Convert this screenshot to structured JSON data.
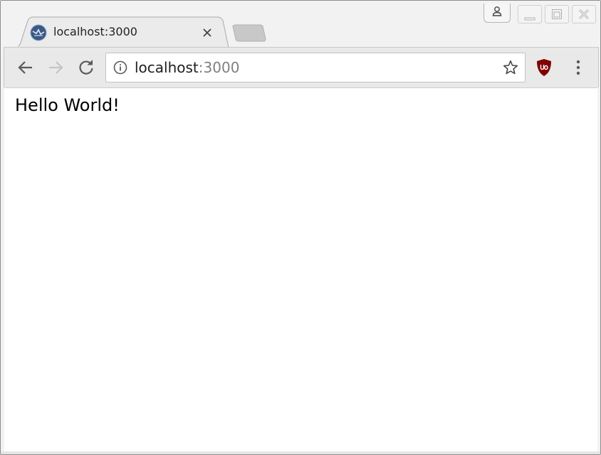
{
  "browser": {
    "tab": {
      "title": "localhost:3000"
    },
    "address_bar": {
      "host": "localhost",
      "port": ":3000"
    },
    "icons": {
      "favicon": "webpack-icon",
      "back": "arrow-left-icon",
      "forward": "arrow-right-icon",
      "reload": "reload-icon",
      "info": "info-icon",
      "bookmark": "star-icon",
      "extension": "ublock-shield-icon",
      "menu": "kebab-menu-icon",
      "profile": "person-icon"
    },
    "colors": {
      "frame": "#f2f2f2",
      "toolbar": "#e9e9e9",
      "ublock_red": "#800000",
      "port_text": "#808080"
    }
  },
  "page": {
    "heading": "Hello World!"
  }
}
